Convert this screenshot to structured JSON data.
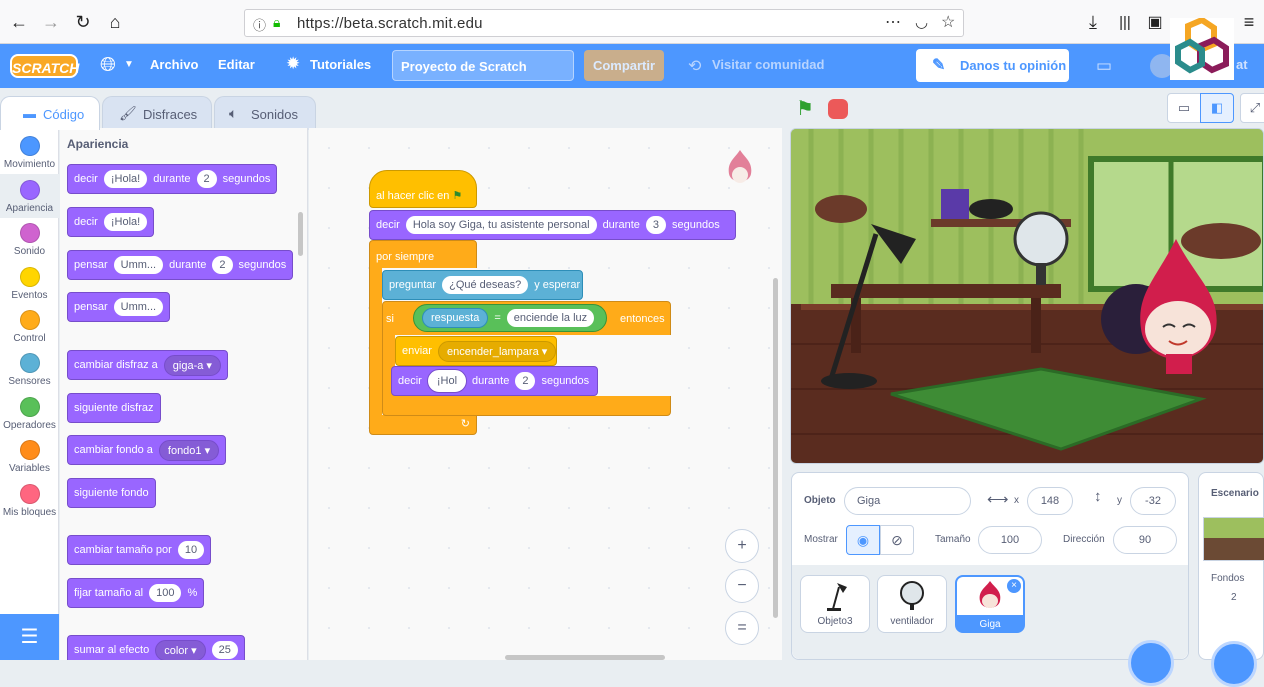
{
  "browser": {
    "url": "https://beta.scratch.mit.edu"
  },
  "menubar": {
    "logo": "SCRATCH",
    "file": "Archivo",
    "edit": "Editar",
    "tutorials": "Tutoriales",
    "project_title": "Proyecto de Scratch",
    "share": "Compartir",
    "see_community": "Visitar comunidad",
    "feedback": "Danos tu opinión",
    "partial_right": "at"
  },
  "tabs": {
    "code": "Código",
    "costumes": "Disfraces",
    "sounds": "Sonidos"
  },
  "categories": [
    {
      "label": "Movimiento",
      "color": "#4c97ff"
    },
    {
      "label": "Apariencia",
      "color": "#9966ff"
    },
    {
      "label": "Sonido",
      "color": "#cf63cf"
    },
    {
      "label": "Eventos",
      "color": "#ffd500"
    },
    {
      "label": "Control",
      "color": "#ffab19"
    },
    {
      "label": "Sensores",
      "color": "#5cb1d6"
    },
    {
      "label": "Operadores",
      "color": "#59c059"
    },
    {
      "label": "Variables",
      "color": "#ff8c1a"
    },
    {
      "label": "Mis bloques",
      "color": "#ff6680"
    }
  ],
  "palette": {
    "heading": "Apariencia",
    "b1": {
      "a": "decir",
      "v1": "¡Hola!",
      "b": "durante",
      "v2": "2",
      "c": "segundos"
    },
    "b2": {
      "a": "decir",
      "v1": "¡Hola!"
    },
    "b3": {
      "a": "pensar",
      "v1": "Umm...",
      "b": "durante",
      "v2": "2",
      "c": "segundos"
    },
    "b4": {
      "a": "pensar",
      "v1": "Umm..."
    },
    "b5": {
      "a": "cambiar disfraz a",
      "v1": "giga-a"
    },
    "b6": {
      "a": "siguiente disfraz"
    },
    "b7": {
      "a": "cambiar fondo a",
      "v1": "fondo1"
    },
    "b8": {
      "a": "siguiente fondo"
    },
    "b9": {
      "a": "cambiar tamaño por",
      "v1": "10"
    },
    "b10": {
      "a": "fijar tamaño al",
      "v1": "100",
      "b": "%"
    },
    "b11": {
      "a": "sumar al efecto",
      "v1": "color",
      "v2": "25"
    }
  },
  "script": {
    "hat": "al hacer clic en",
    "say1": {
      "a": "decir",
      "v1": "Hola soy Giga, tu asistente personal",
      "b": "durante",
      "v2": "3",
      "c": "segundos"
    },
    "forever": "por siempre",
    "ask": {
      "a": "preguntar",
      "v1": "¿Qué deseas?",
      "b": "y esperar"
    },
    "if": {
      "a": "si",
      "reporter": "respuesta",
      "eq": "=",
      "v1": "enciende la luz",
      "b": "entonces"
    },
    "broadcast": {
      "a": "enviar",
      "v1": "encender_lampara"
    },
    "say2": {
      "a": "decir",
      "v1": "¡Hol",
      "b": "durante",
      "v2": "2",
      "c": "segundos"
    }
  },
  "zoom": {
    "in": "+",
    "out": "−",
    "reset": "="
  },
  "sprite_info": {
    "sprite_label": "Objeto",
    "sprite_name": "Giga",
    "x_label": "x",
    "x": "148",
    "y_label": "y",
    "y": "-32",
    "show_label": "Mostrar",
    "size_label": "Tamaño",
    "size": "100",
    "direction_label": "Dirección",
    "direction": "90"
  },
  "sprites": [
    {
      "name": "Objeto3",
      "selected": false
    },
    {
      "name": "ventilador",
      "selected": false
    },
    {
      "name": "Giga",
      "selected": true
    }
  ],
  "stage_pane": {
    "title": "Escenario",
    "backdrops_label": "Fondos",
    "backdrops_count": "2"
  },
  "colors": {
    "accent": "#4d97ff",
    "looks": "#9966ff",
    "control": "#ffab19",
    "events": "#ffbf00",
    "sensing": "#5cb1d6",
    "operators": "#59c059"
  }
}
